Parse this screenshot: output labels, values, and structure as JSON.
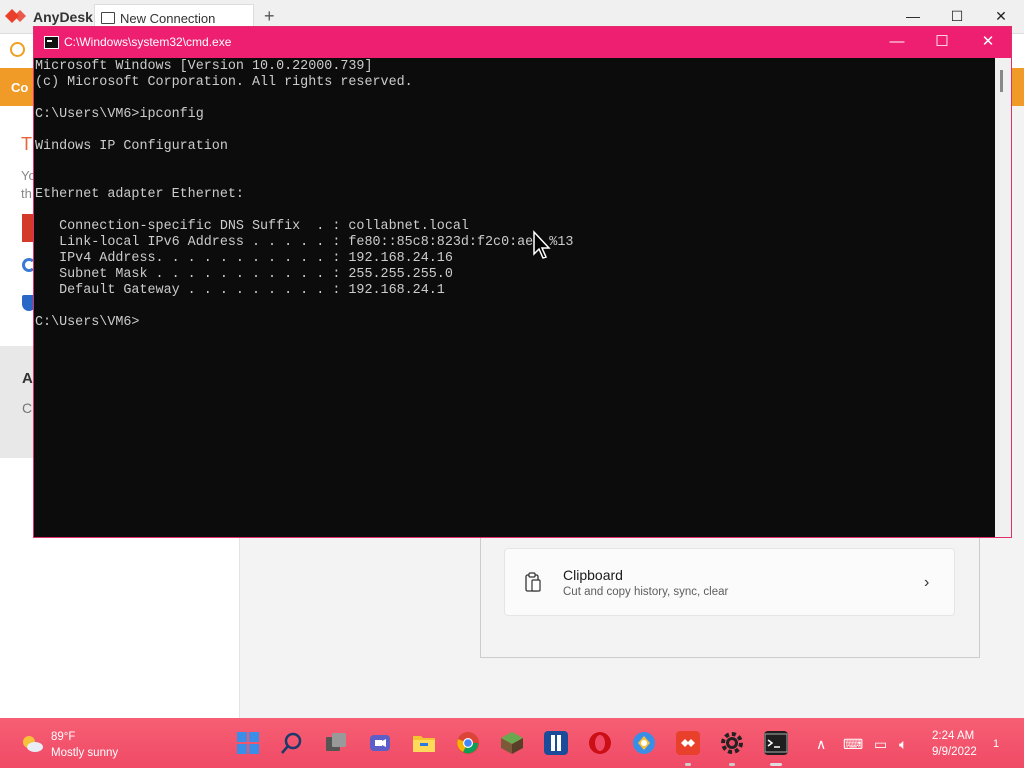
{
  "anydesk": {
    "app_name": "AnyDesk",
    "tab_label": "New Connection",
    "orange_bar_text": "Co",
    "left_title": "T",
    "left_small_1": "Yo",
    "left_small_2": "th",
    "grey_heading": "A",
    "grey_text": "Cl"
  },
  "settings": {
    "clipboard_title": "Clipboard",
    "clipboard_subtitle": "Cut and copy history, sync, clear"
  },
  "cmd": {
    "title": "C:\\Windows\\system32\\cmd.exe",
    "lines": [
      "Microsoft Windows [Version 10.0.22000.739]",
      "(c) Microsoft Corporation. All rights reserved.",
      "",
      "C:\\Users\\VM6>ipconfig",
      "",
      "Windows IP Configuration",
      "",
      "",
      "Ethernet adapter Ethernet:",
      "",
      "   Connection-specific DNS Suffix  . : collabnet.local",
      "   Link-local IPv6 Address . . . . . : fe80::85c8:823d:f2c0:ae  %13",
      "   IPv4 Address. . . . . . . . . . . : 192.168.24.16",
      "   Subnet Mask . . . . . . . . . . . : 255.255.255.0",
      "   Default Gateway . . . . . . . . . : 192.168.24.1",
      "",
      "C:\\Users\\VM6>"
    ]
  },
  "taskbar": {
    "temperature": "89°F",
    "weather": "Mostly sunny",
    "time": "2:24 AM",
    "date": "9/9/2022",
    "notification_count": "1",
    "apps": [
      "start-icon",
      "search-icon",
      "task-view-icon",
      "teams-chat-icon",
      "file-explorer-icon",
      "chrome-icon",
      "minecraft-icon",
      "app-icon",
      "opera-icon",
      "browser-icon",
      "anydesk-icon",
      "settings-icon",
      "terminal-icon"
    ]
  },
  "colors": {
    "cmd_titlebar": "#ee1f70",
    "taskbar": "#f04a66",
    "anydesk_orange": "#f09a28",
    "anydesk_red": "#e8402a"
  }
}
